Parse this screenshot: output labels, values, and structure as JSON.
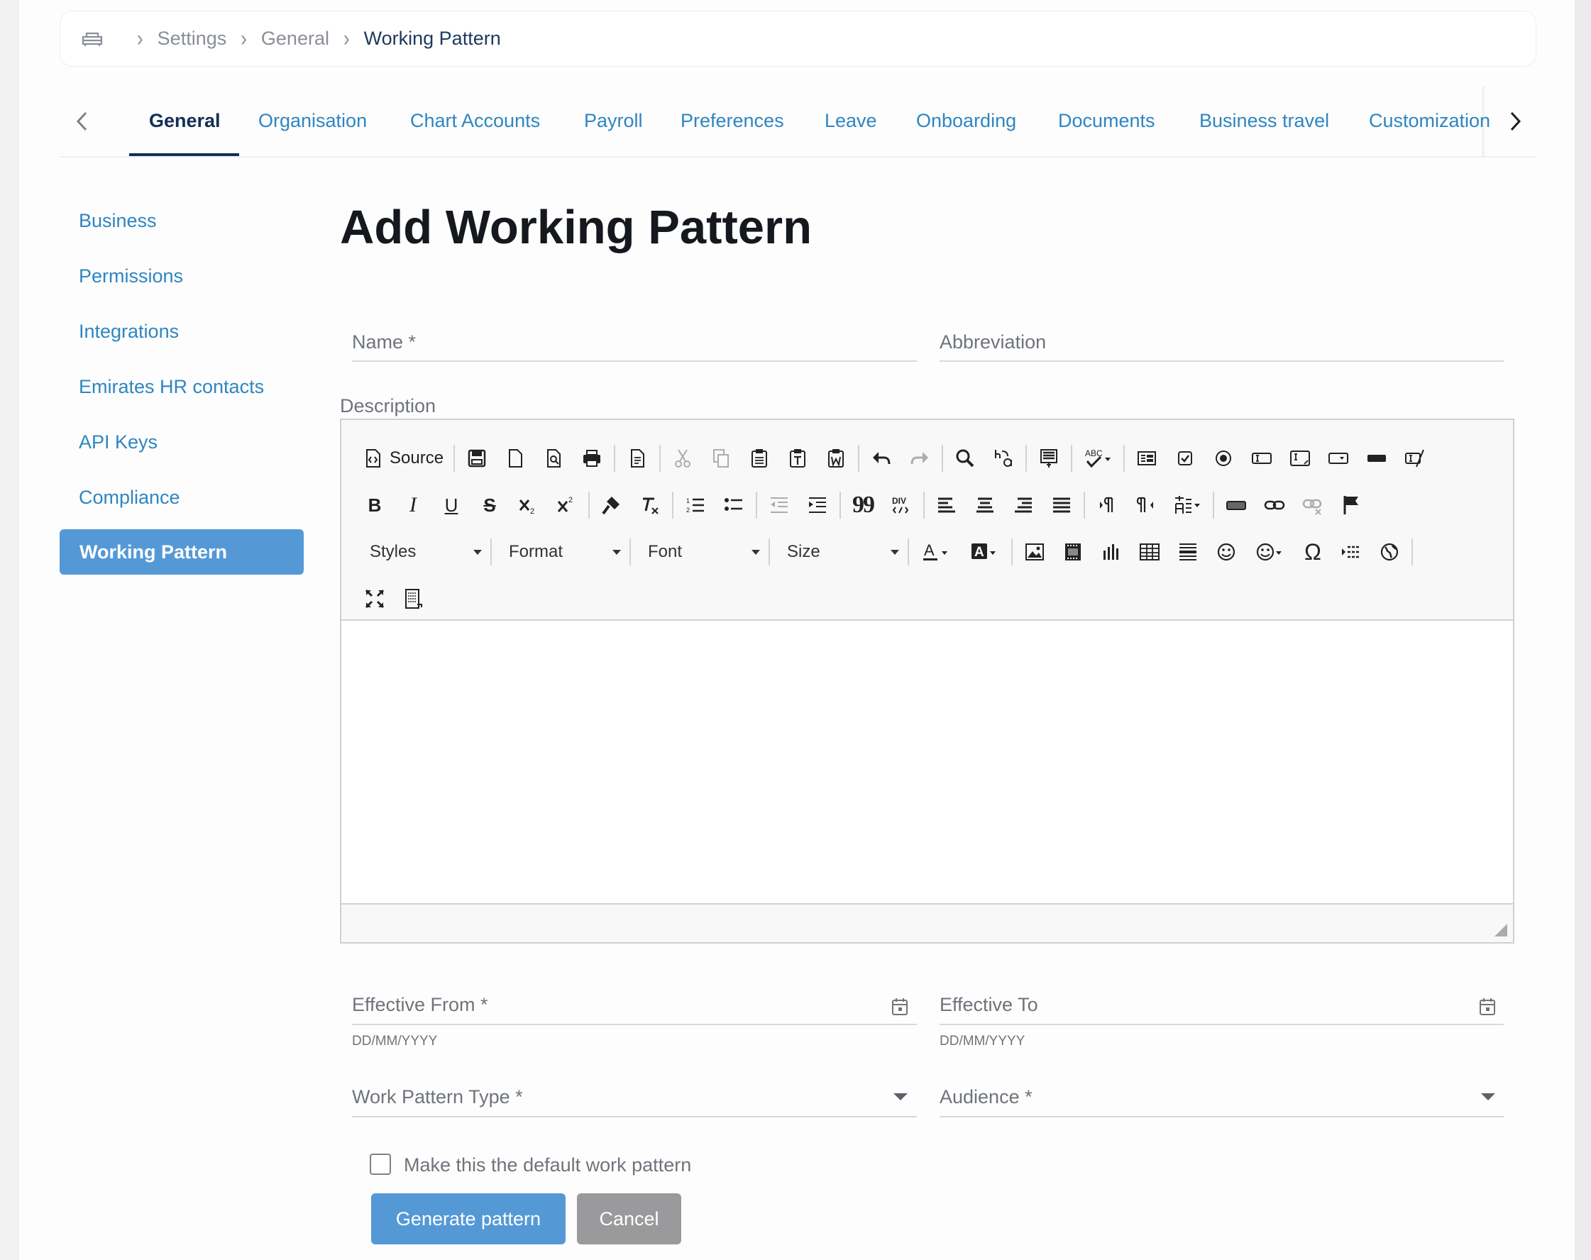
{
  "breadcrumb": {
    "items": [
      "Settings",
      "General",
      "Working Pattern"
    ]
  },
  "tabs": [
    "General",
    "Organisation",
    "Chart Accounts",
    "Payroll",
    "Preferences",
    "Leave",
    "Onboarding",
    "Documents",
    "Business travel",
    "Customization"
  ],
  "sidebar": {
    "items": [
      "Business",
      "Permissions",
      "Integrations",
      "Emirates HR contacts",
      "API Keys",
      "Compliance",
      "Working Pattern"
    ]
  },
  "form": {
    "title": "Add Working Pattern",
    "name_label": "Name *",
    "abbreviation_label": "Abbreviation",
    "description_label": "Description",
    "effective_from_label": "Effective From *",
    "effective_from_helper": "DD/MM/YYYY",
    "effective_to_label": "Effective To",
    "effective_to_helper": "DD/MM/YYYY",
    "work_pattern_type_label": "Work Pattern Type *",
    "audience_label": "Audience *",
    "default_checkbox_label": "Make this the default work pattern",
    "generate_button": "Generate pattern",
    "cancel_button": "Cancel"
  },
  "editor": {
    "source_label": "Source",
    "styles_label": "Styles",
    "format_label": "Format",
    "font_label": "Font",
    "size_label": "Size",
    "bold_glyph": "B",
    "italic_glyph": "I",
    "underline_glyph": "U",
    "strike_glyph": "S",
    "omega_glyph": "Ω",
    "quote_glyph": "99"
  },
  "colors": {
    "accent": "#5499d6",
    "link": "#2e86c1",
    "active_tab": "#132f55",
    "cancel": "#9a9a9c"
  }
}
